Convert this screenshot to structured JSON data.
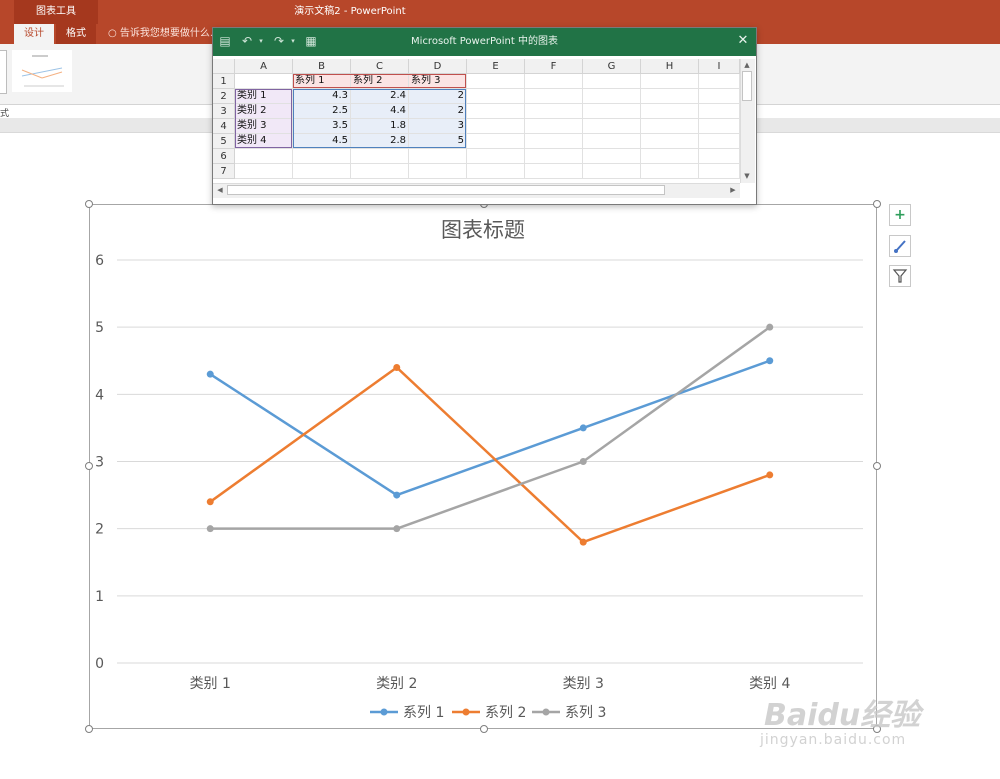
{
  "window": {
    "context_group": "图表工具",
    "title": "演示文稿2 - PowerPoint"
  },
  "ribbon": {
    "tabs": [
      {
        "label": "设计",
        "active": true
      },
      {
        "label": "格式",
        "active": false
      }
    ],
    "tell_me": "告诉我您想要做什么...",
    "group_label": "样式"
  },
  "sheet": {
    "title": "Microsoft PowerPoint 中的图表",
    "columns": [
      "A",
      "B",
      "C",
      "D",
      "E",
      "F",
      "G",
      "H",
      "I"
    ],
    "rows": [
      "1",
      "2",
      "3",
      "4",
      "5",
      "6",
      "7"
    ],
    "cells": [
      [
        "",
        "系列 1",
        "系列 2",
        "系列 3"
      ],
      [
        "类别 1",
        "4.3",
        "2.4",
        "2"
      ],
      [
        "类别 2",
        "2.5",
        "4.4",
        "2"
      ],
      [
        "类别 3",
        "3.5",
        "1.8",
        "3"
      ],
      [
        "类别 4",
        "4.5",
        "2.8",
        "5"
      ]
    ]
  },
  "chart_data": {
    "type": "line",
    "title": "图表标题",
    "categories": [
      "类别 1",
      "类别 2",
      "类别 3",
      "类别 4"
    ],
    "series": [
      {
        "name": "系列 1",
        "values": [
          4.3,
          2.5,
          3.5,
          4.5
        ],
        "color": "#5b9bd5"
      },
      {
        "name": "系列 2",
        "values": [
          2.4,
          4.4,
          1.8,
          2.8
        ],
        "color": "#ed7d31"
      },
      {
        "name": "系列 3",
        "values": [
          2,
          2,
          3,
          5
        ],
        "color": "#a5a5a5"
      }
    ],
    "yticks": [
      "0",
      "1",
      "2",
      "3",
      "4",
      "5",
      "6"
    ],
    "ylim": [
      0,
      6
    ],
    "grid": true,
    "legend": "bottom"
  },
  "watermark": {
    "brand": "Baidu经验",
    "url": "jingyan.baidu.com"
  }
}
